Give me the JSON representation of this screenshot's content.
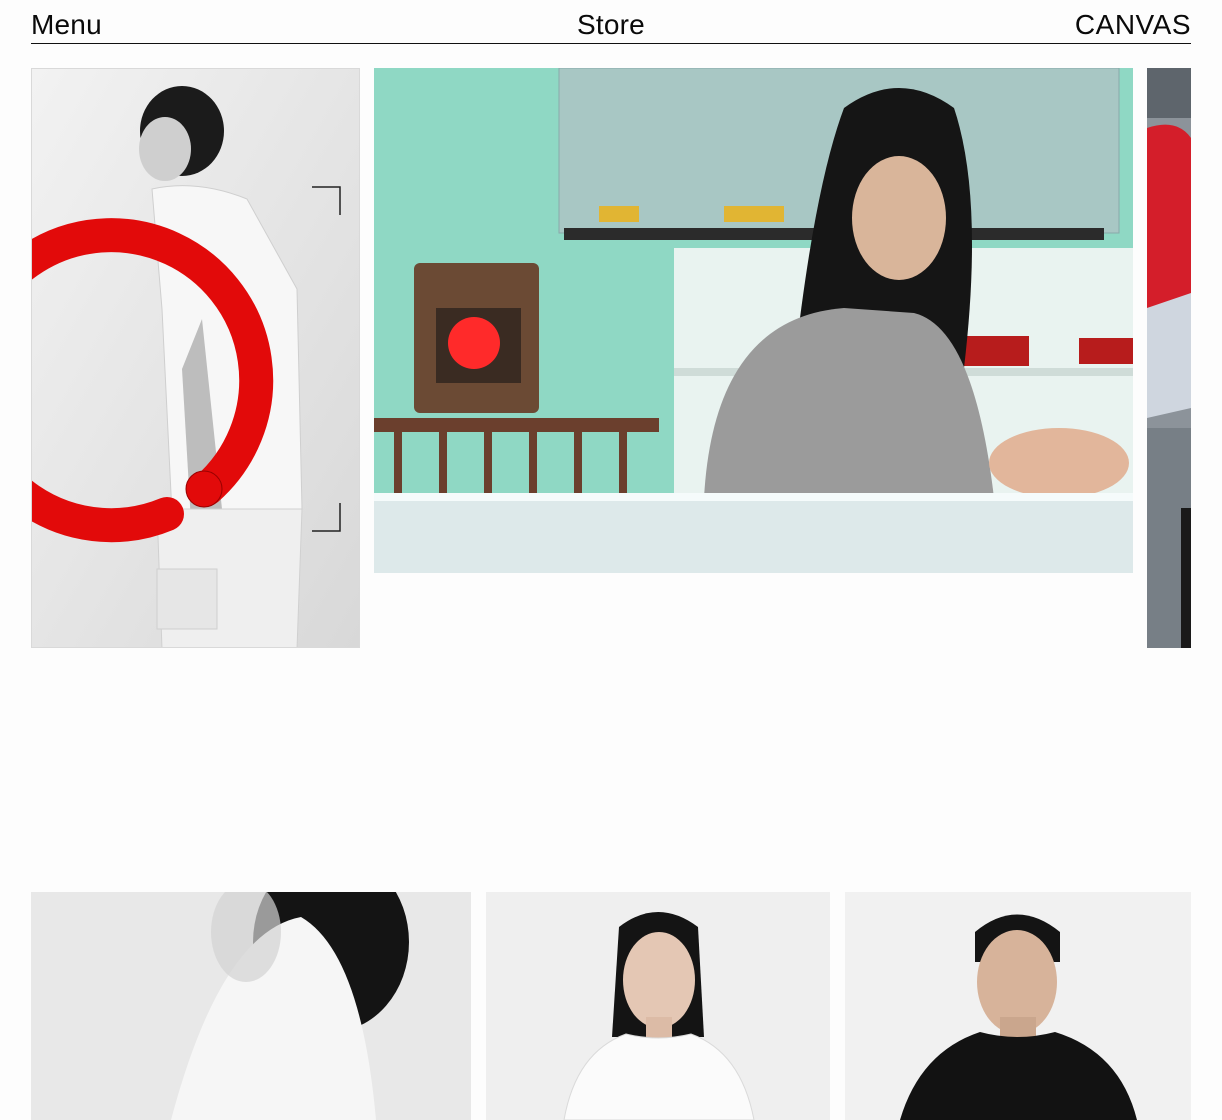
{
  "header": {
    "menu_label": "Menu",
    "store_label": "Store",
    "brand_label": "CANVAS"
  },
  "colors": {
    "accent_red": "#e20a0a",
    "text": "#0a0a0a",
    "background": "#fdfdfd"
  }
}
